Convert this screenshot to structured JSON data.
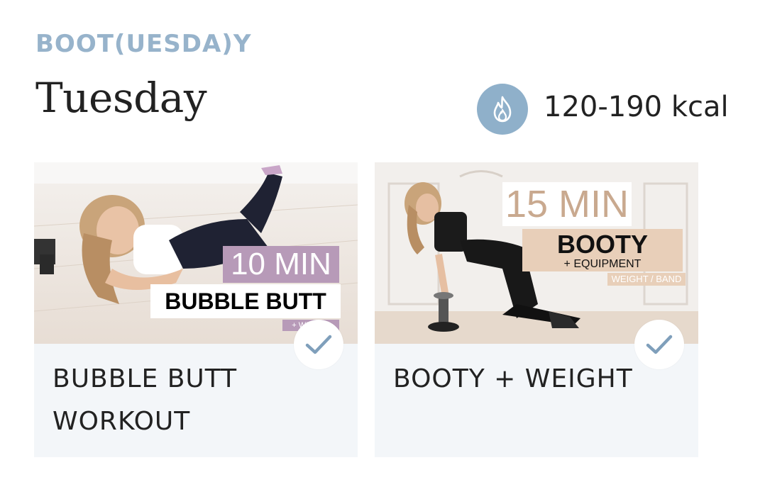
{
  "section_label": "BOOT(UESDA)Y",
  "day_title": "Tuesday",
  "calories": {
    "icon": "flame-icon",
    "text": "120-190 kcal",
    "badge_color": "#8fb0ca"
  },
  "workouts": [
    {
      "title": "BUBBLE BUTT WORKOUT",
      "completed": true,
      "thumbnail": {
        "duration_label": "10 MIN",
        "subtitle": "BUBBLE BUTT",
        "tag": "+ WEIGHT"
      }
    },
    {
      "title": "BOOTY + WEIGHT",
      "completed": true,
      "thumbnail": {
        "duration_label": "15 MIN",
        "subtitle": "BOOTY",
        "subtitle_detail": "+ EQUIPMENT",
        "tag": "WEIGHT / BAND"
      }
    }
  ],
  "colors": {
    "accent": "#97b3cb",
    "check": "#7f9fbb",
    "card_bg": "#f3f6f9"
  }
}
